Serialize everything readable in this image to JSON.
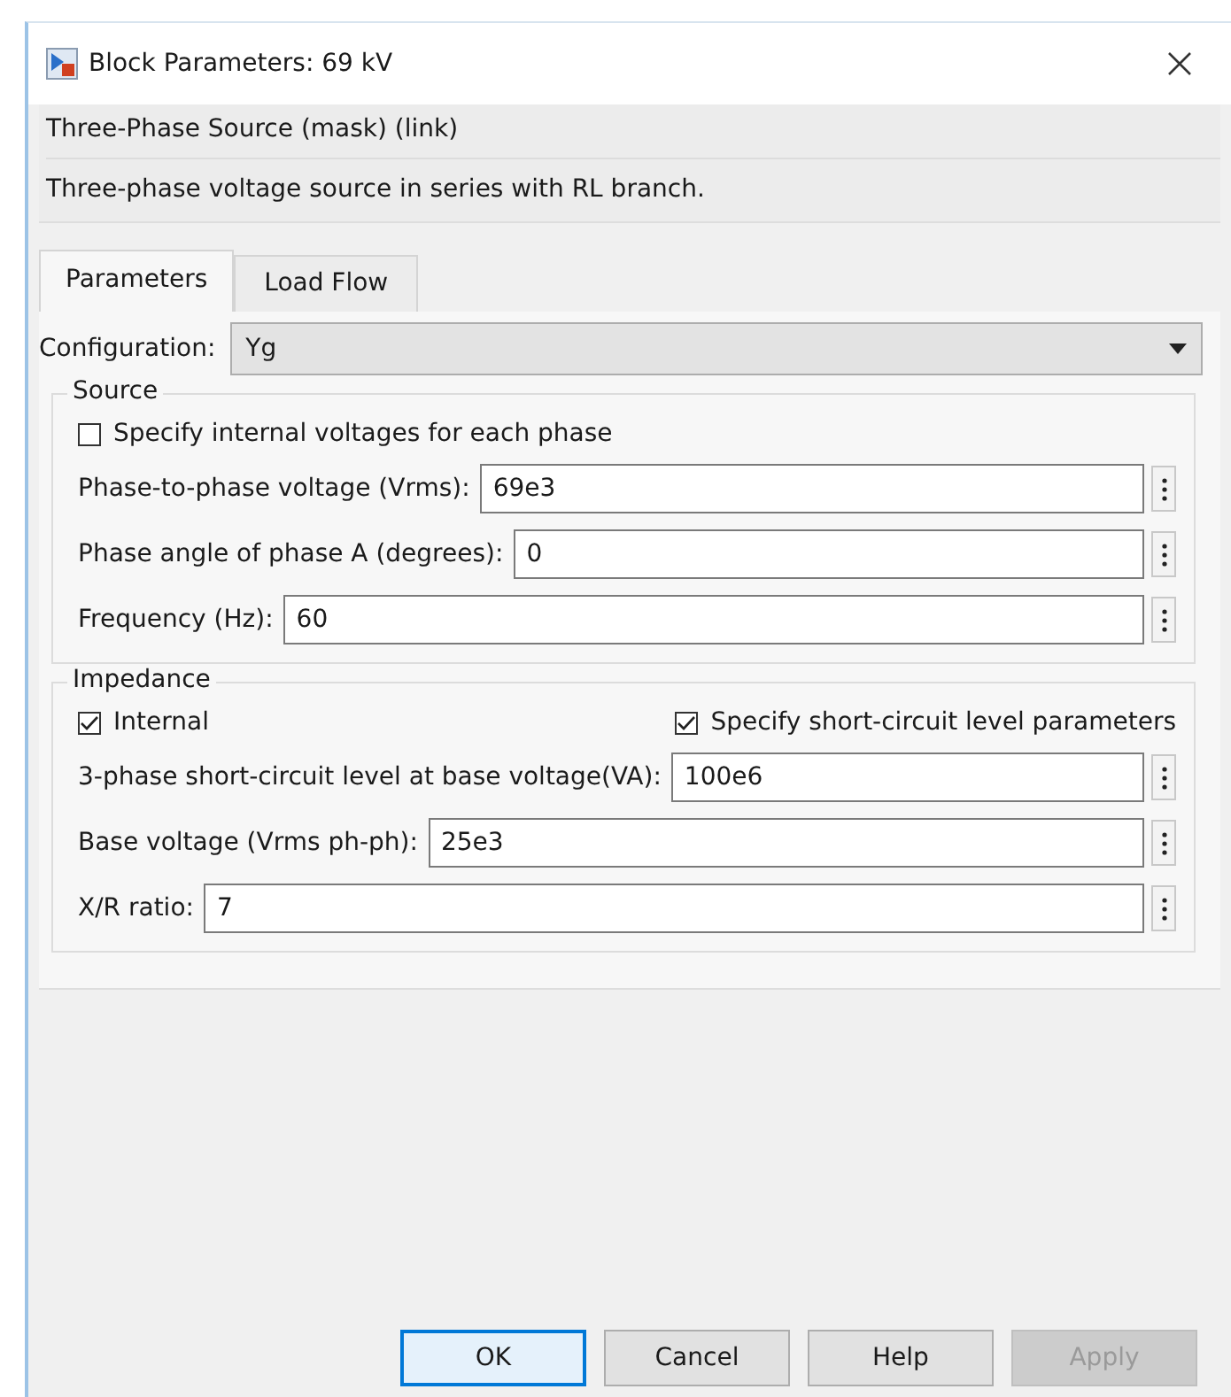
{
  "window": {
    "title": "Block Parameters: 69 kV"
  },
  "header": {
    "mask_title": "Three-Phase Source (mask) (link)",
    "description": "Three-phase voltage source in series with RL branch."
  },
  "tabs": [
    {
      "label": "Parameters",
      "selected": true
    },
    {
      "label": "Load Flow",
      "selected": false
    }
  ],
  "configuration": {
    "label": "Configuration:",
    "value": "Yg"
  },
  "groups": [
    {
      "title": "Source",
      "checkboxes": [
        {
          "label": "Specify internal voltages for each phase",
          "checked": false
        }
      ],
      "fields": [
        {
          "label": "Phase-to-phase voltage (Vrms):",
          "value": "69e3"
        },
        {
          "label": "Phase angle of phase A (degrees):",
          "value": "0"
        },
        {
          "label": "Frequency (Hz):",
          "value": "60"
        }
      ]
    },
    {
      "title": "Impedance",
      "checkboxes": [
        {
          "label": "Internal",
          "checked": true
        },
        {
          "label": "Specify short-circuit level parameters",
          "checked": true
        }
      ],
      "fields": [
        {
          "label": "3-phase short-circuit level at base voltage(VA):",
          "value": "100e6"
        },
        {
          "label": "Base voltage (Vrms ph-ph):",
          "value": "25e3"
        },
        {
          "label": "X/R ratio:",
          "value": "7"
        }
      ]
    }
  ],
  "buttons": [
    {
      "label": "OK",
      "default": true,
      "disabled": false
    },
    {
      "label": "Cancel",
      "default": false,
      "disabled": false
    },
    {
      "label": "Help",
      "default": false,
      "disabled": false
    },
    {
      "label": "Apply",
      "default": false,
      "disabled": true
    }
  ]
}
